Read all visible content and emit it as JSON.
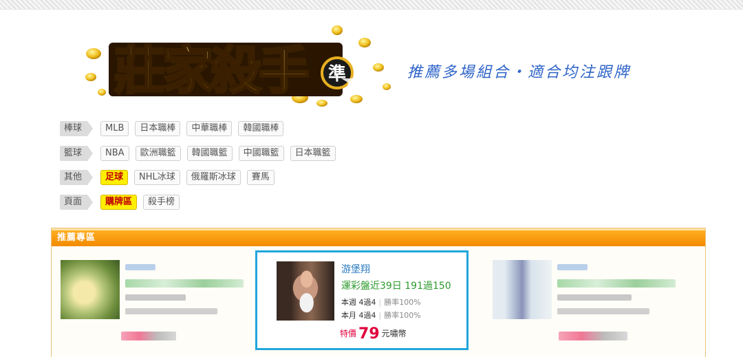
{
  "logo": {
    "title": "莊家殺手",
    "badge": "準"
  },
  "slogan": "推薦多場組合・適合均注跟牌",
  "categories": [
    {
      "label": "棒球",
      "items": [
        "MLB",
        "日本職棒",
        "中華職棒",
        "韓國職棒"
      ],
      "active": -1
    },
    {
      "label": "籃球",
      "items": [
        "NBA",
        "歐洲職籃",
        "韓國職籃",
        "中國職籃",
        "日本職籃"
      ],
      "active": -1
    },
    {
      "label": "其他",
      "items": [
        "足球",
        "NHL冰球",
        "俄羅斯冰球",
        "賽馬"
      ],
      "active": 0
    },
    {
      "label": "頁面",
      "items": [
        "購牌區",
        "殺手榜"
      ],
      "active": 0
    }
  ],
  "panel": {
    "title": "推薦專區"
  },
  "featured": {
    "name": "游堡翔",
    "record": "運彩盤近39日 191過150",
    "week_label": "本週 4過4",
    "week_rate": "勝率100%",
    "month_label": "本月 4過4",
    "month_rate": "勝率100%",
    "price_prefix": "特價",
    "price": "79",
    "price_unit": "元嘯幣"
  },
  "colors": {
    "accent_blue": "#20a6dc",
    "panel_orange": "#f28a00",
    "active_chip": "#ffee00",
    "price_red": "#e0003c"
  }
}
